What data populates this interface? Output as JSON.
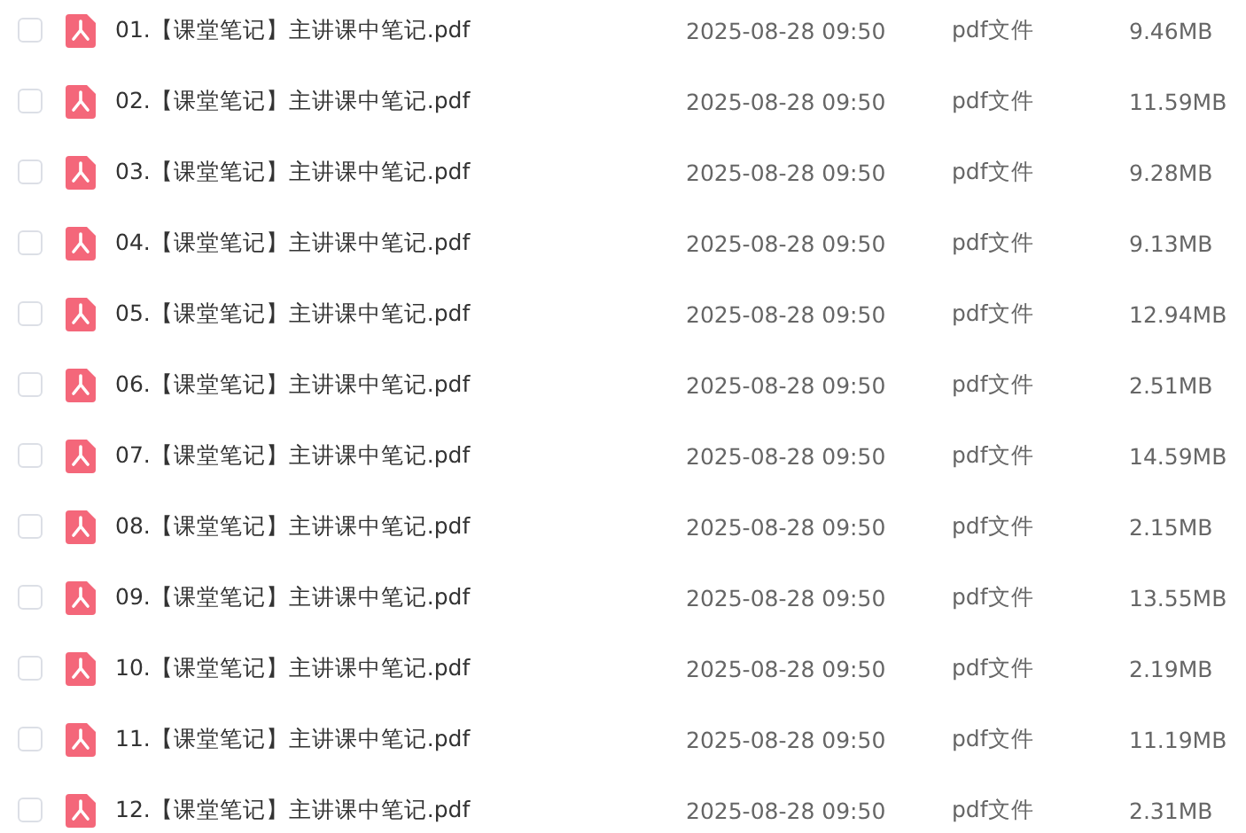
{
  "files": [
    {
      "checked": false,
      "name": "01.【课堂笔记】主讲课中笔记.pdf",
      "date": "2025-08-28 09:50",
      "type": "pdf文件",
      "size": "9.46MB"
    },
    {
      "checked": false,
      "name": "02.【课堂笔记】主讲课中笔记.pdf",
      "date": "2025-08-28 09:50",
      "type": "pdf文件",
      "size": "11.59MB"
    },
    {
      "checked": false,
      "name": "03.【课堂笔记】主讲课中笔记.pdf",
      "date": "2025-08-28 09:50",
      "type": "pdf文件",
      "size": "9.28MB"
    },
    {
      "checked": false,
      "name": "04.【课堂笔记】主讲课中笔记.pdf",
      "date": "2025-08-28 09:50",
      "type": "pdf文件",
      "size": "9.13MB"
    },
    {
      "checked": false,
      "name": "05.【课堂笔记】主讲课中笔记.pdf",
      "date": "2025-08-28 09:50",
      "type": "pdf文件",
      "size": "12.94MB"
    },
    {
      "checked": false,
      "name": "06.【课堂笔记】主讲课中笔记.pdf",
      "date": "2025-08-28 09:50",
      "type": "pdf文件",
      "size": "2.51MB"
    },
    {
      "checked": false,
      "name": "07.【课堂笔记】主讲课中笔记.pdf",
      "date": "2025-08-28 09:50",
      "type": "pdf文件",
      "size": "14.59MB"
    },
    {
      "checked": false,
      "name": "08.【课堂笔记】主讲课中笔记.pdf",
      "date": "2025-08-28 09:50",
      "type": "pdf文件",
      "size": "2.15MB"
    },
    {
      "checked": false,
      "name": "09.【课堂笔记】主讲课中笔记.pdf",
      "date": "2025-08-28 09:50",
      "type": "pdf文件",
      "size": "13.55MB"
    },
    {
      "checked": false,
      "name": "10.【课堂笔记】主讲课中笔记.pdf",
      "date": "2025-08-28 09:50",
      "type": "pdf文件",
      "size": "2.19MB"
    },
    {
      "checked": false,
      "name": "11.【课堂笔记】主讲课中笔记.pdf",
      "date": "2025-08-28 09:50",
      "type": "pdf文件",
      "size": "11.19MB"
    },
    {
      "checked": false,
      "name": "12.【课堂笔记】主讲课中笔记.pdf",
      "date": "2025-08-28 09:50",
      "type": "pdf文件",
      "size": "2.31MB"
    }
  ]
}
